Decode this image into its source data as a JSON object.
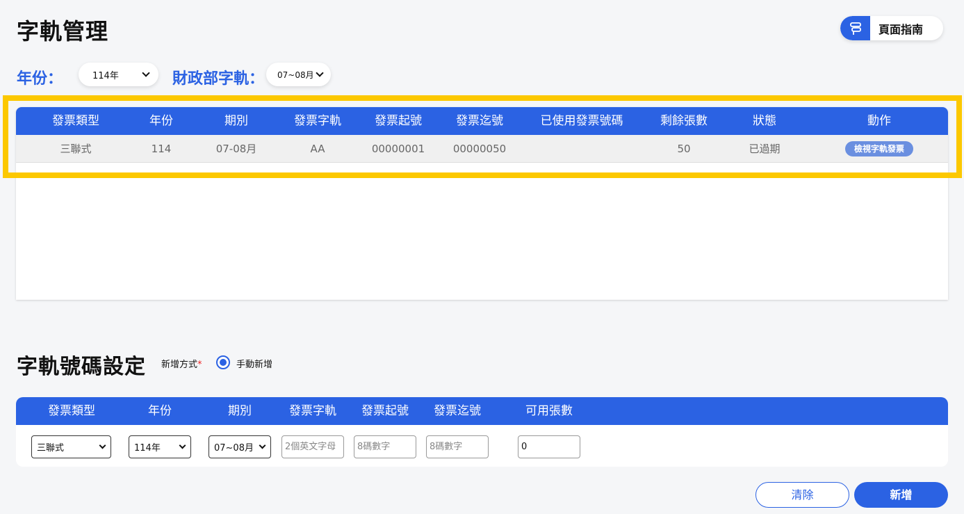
{
  "header": {
    "title": "字軌管理",
    "guide_button": {
      "label": "頁面指南",
      "icon": "guide-icon"
    }
  },
  "filters": {
    "year_label": "年份：",
    "year_value": "114年",
    "track_label": "財政部字軌：",
    "track_value": "07~08月"
  },
  "track_table": {
    "columns": [
      "發票類型",
      "年份",
      "期別",
      "發票字軌",
      "發票起號",
      "發票迄號",
      "已使用發票號碼",
      "剩餘張數",
      "狀態",
      "動作"
    ],
    "rows": [
      {
        "type": "三聯式",
        "year": "114",
        "period": "07-08月",
        "track": "AA",
        "start": "00000001",
        "end": "00000050",
        "used": "",
        "remaining": "50",
        "status": "已過期",
        "action": "檢視字軌發票"
      }
    ]
  },
  "settings": {
    "title": "字軌號碼設定",
    "method_label": "新增方式",
    "required_mark": "*",
    "method_option": "手動新增",
    "columns": [
      "發票類型",
      "年份",
      "期別",
      "發票字軌",
      "發票起號",
      "發票迄號",
      "可用張數"
    ],
    "form": {
      "type_value": "三聯式",
      "year_value": "114年",
      "period_value": "07~08月",
      "track_placeholder": "2個英文字母",
      "start_placeholder": "8碼數字",
      "end_placeholder": "8碼數字",
      "available_value": "0"
    },
    "buttons": {
      "clear": "清除",
      "add": "新增"
    }
  },
  "colors": {
    "primary": "#2b62e3",
    "highlight": "#fcc800",
    "action_badge": "#6a8fe0"
  }
}
